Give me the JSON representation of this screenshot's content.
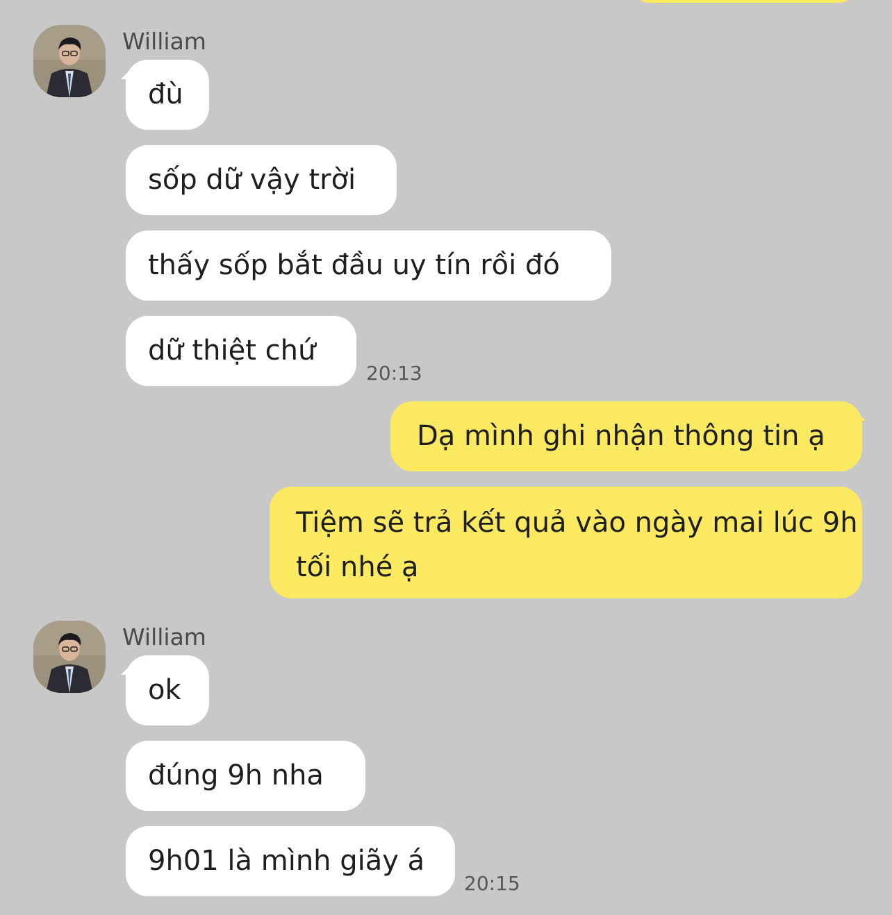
{
  "colors": {
    "background": "#c8c8c8",
    "incoming_bubble": "#ffffff",
    "outgoing_bubble": "#fbe962",
    "timestamp": "#555555",
    "sender_name": "#4a4a4a"
  },
  "conversation": {
    "groups": [
      {
        "sender": "William",
        "avatar_icon": "user-photo-avatar",
        "messages": [
          "đù",
          "sốp dữ vậy trời",
          "thấy sốp bắt đầu uy tín rồi đó",
          "dữ thiệt chứ"
        ],
        "time": "20:13"
      },
      {
        "sender": "me",
        "messages": [
          "Dạ mình ghi nhận thông tin ạ",
          "Tiệm sẽ trả kết quả vào ngày mai lúc 9h tối nhé ạ"
        ]
      },
      {
        "sender": "William",
        "avatar_icon": "user-photo-avatar",
        "messages": [
          "ok",
          "đúng 9h nha",
          "9h01 là mình giãy á"
        ],
        "time": "20:15"
      }
    ]
  }
}
